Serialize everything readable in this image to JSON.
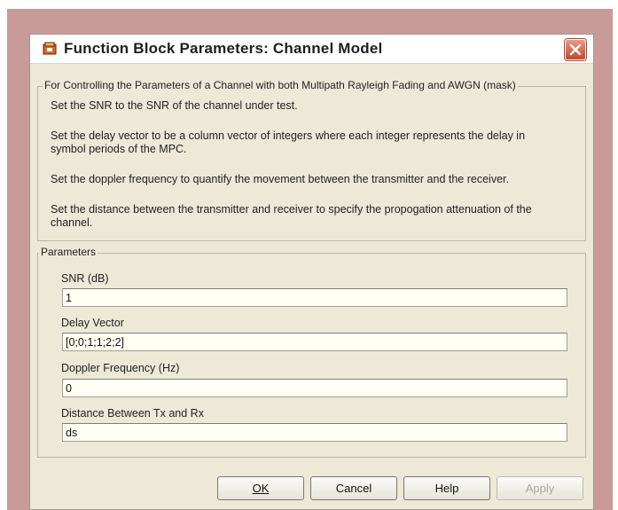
{
  "window": {
    "title": "Function Block Parameters: Channel Model",
    "icon": "simulink-block-icon",
    "close_icon": "close-icon"
  },
  "description_group": {
    "legend": "For Controlling the Parameters of a Channel with both Multipath Rayleigh Fading and AWGN (mask)",
    "lines": [
      "Set the SNR to the SNR of the channel under test.",
      "Set the delay vector to be a column vector of integers where each integer represents the delay in symbol periods of the MPC.",
      "Set the doppler frequency to quantify the movement between the transmitter and the receiver.",
      "Set the distance between the transmitter and receiver to specify the propogation attenuation of the channel."
    ]
  },
  "parameters_group": {
    "legend": "Parameters",
    "fields": [
      {
        "label": "SNR (dB)",
        "value": "1"
      },
      {
        "label": "Delay Vector",
        "value": "[0;0;1;1;2;2]"
      },
      {
        "label": "Doppler Frequency (Hz)",
        "value": "0"
      },
      {
        "label": "Distance Between Tx and Rx",
        "value": "ds"
      }
    ]
  },
  "buttons": {
    "ok": "OK",
    "cancel": "Cancel",
    "help": "Help",
    "apply": "Apply"
  },
  "colors": {
    "dialog_bg": "#ece9d8",
    "frame_bg": "#c89a98",
    "close_red": "#c8472a"
  }
}
